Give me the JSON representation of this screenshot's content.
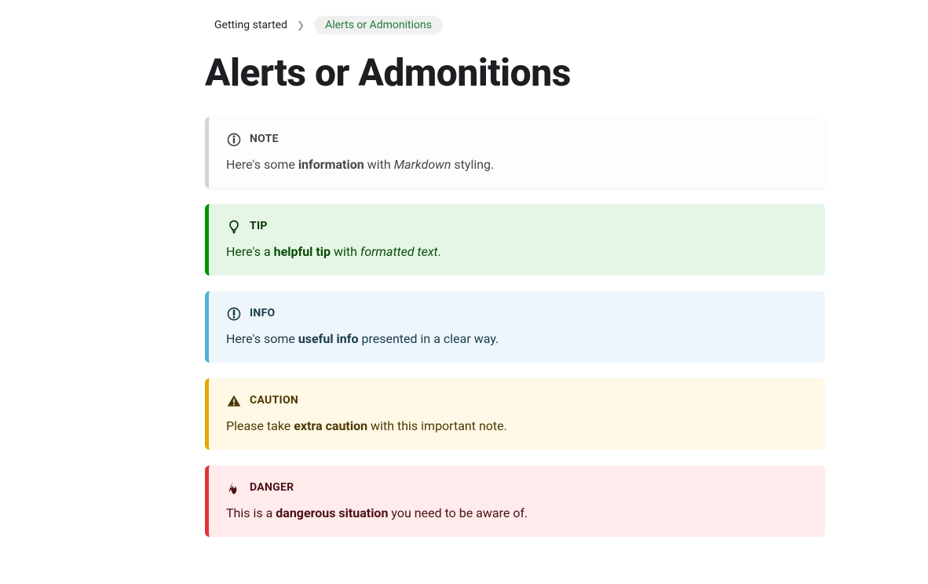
{
  "breadcrumb": {
    "parent": "Getting started",
    "current": "Alerts or Admonitions"
  },
  "page_title": "Alerts or Admonitions",
  "note": {
    "label": "NOTE",
    "body_pre": "Here's some ",
    "body_strong": "information",
    "body_mid": " with ",
    "body_em": "Markdown",
    "body_post": " styling."
  },
  "tip": {
    "label": "TIP",
    "body_pre": "Here's a ",
    "body_strong": "helpful tip",
    "body_mid": " with ",
    "body_em": "formatted text",
    "body_post": "."
  },
  "info": {
    "label": "INFO",
    "body_pre": "Here's some ",
    "body_strong": "useful info",
    "body_post": " presented in a clear way."
  },
  "caution": {
    "label": "CAUTION",
    "body_pre": "Please take ",
    "body_strong": "extra caution",
    "body_post": " with this important note."
  },
  "danger": {
    "label": "DANGER",
    "body_pre": "This is a ",
    "body_strong": "dangerous situation",
    "body_post": " you need to be aware of."
  }
}
